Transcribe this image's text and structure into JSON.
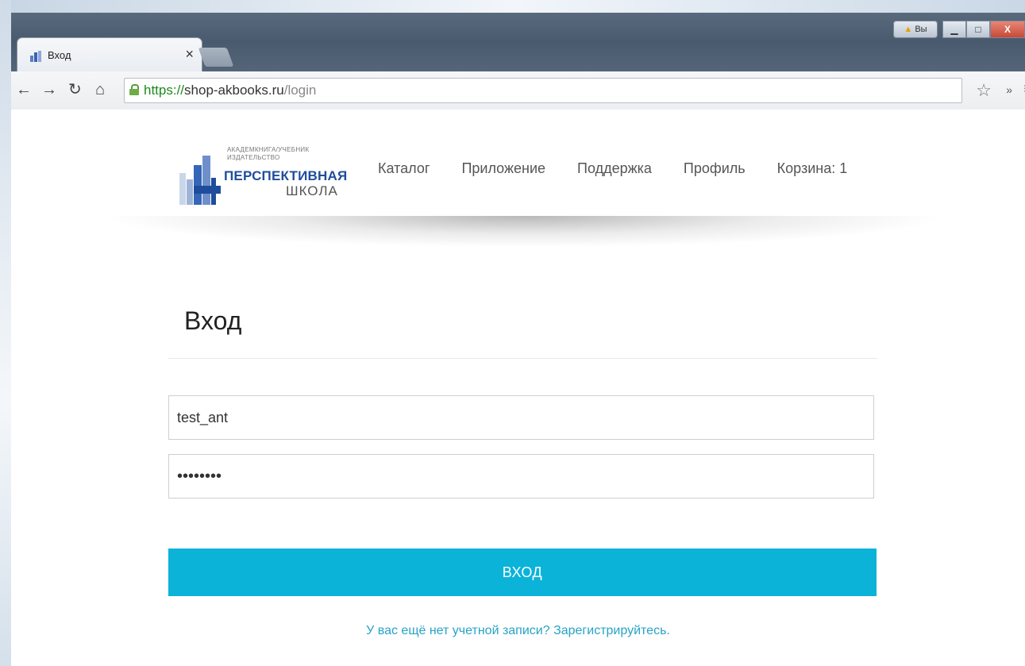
{
  "browser": {
    "tab_title": "Вход",
    "tab_close": "×",
    "warning_label": "Вы",
    "url": {
      "scheme": "https://",
      "host": "shop-akbooks.ru",
      "path": "/login"
    }
  },
  "site": {
    "logo": {
      "line1": "АКАДЕМКНИГА/УЧЕБНИК",
      "line2": "ИЗДАТЕЛЬСТВО",
      "main": "ПЕРСПЕКТИВНАЯ",
      "sub": "ШКОЛА"
    },
    "nav": [
      {
        "label": "Каталог"
      },
      {
        "label": "Приложение"
      },
      {
        "label": "Поддержка"
      },
      {
        "label": "Профиль"
      },
      {
        "label": "Корзина: 1"
      }
    ]
  },
  "login": {
    "title": "Вход",
    "username_value": "test_ant",
    "password_value": "••••••••",
    "submit_label": "ВХОД",
    "register_text": "У вас ещё нет учетной записи? Зарегистрируйтесь."
  },
  "colors": {
    "accent": "#0bb3d9",
    "link": "#27a3c6",
    "brand": "#1f4d9c"
  }
}
